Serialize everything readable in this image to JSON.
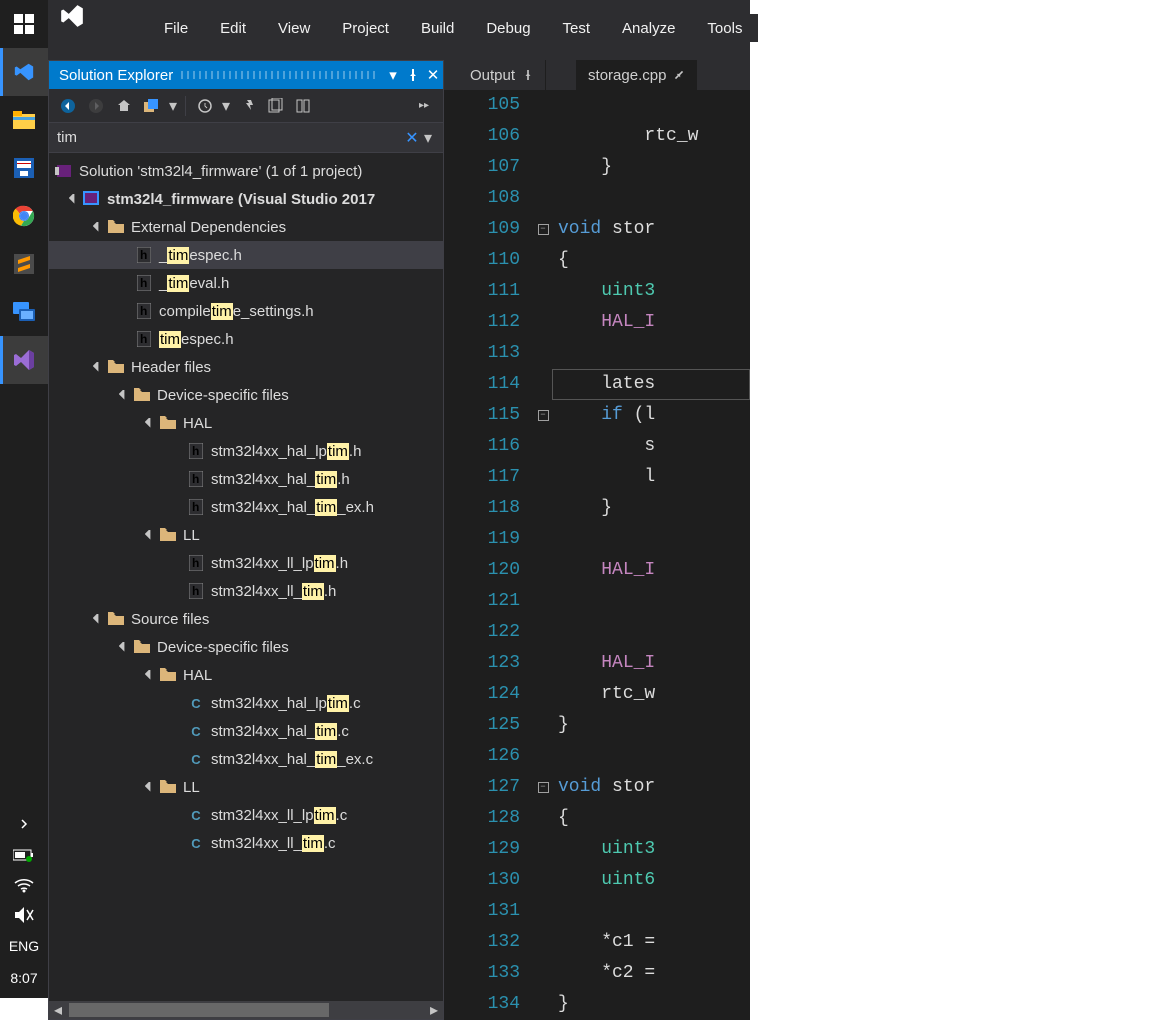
{
  "taskbar": {
    "items": [
      "start",
      "vscode",
      "file-explorer",
      "save",
      "chrome",
      "sublime",
      "remote",
      "visual-studio"
    ],
    "lang": "ENG",
    "time": "8:07"
  },
  "menubar": [
    "File",
    "Edit",
    "View",
    "Project",
    "Build",
    "Debug",
    "Test",
    "Analyze",
    "Tools"
  ],
  "solution_explorer": {
    "title": "Solution Explorer",
    "search": "tim",
    "solution_line": "Solution 'stm32l4_firmware' (1 of 1 project)",
    "project": "stm32l4_firmware (Visual Studio 2017",
    "ext_deps": "External Dependencies",
    "files": {
      "timespec_h": {
        "pre": "_",
        "hl": "tim",
        "post": "espec.h"
      },
      "timeval_h": {
        "pre": "_",
        "hl": "tim",
        "post": "eval.h"
      },
      "compiletime": {
        "pre": "compile",
        "hl": "tim",
        "post": "e_settings.h"
      },
      "timespec2": {
        "pre": "",
        "hl": "tim",
        "post": "espec.h"
      }
    },
    "header_files": "Header files",
    "device_specific": "Device-specific files",
    "hal": "HAL",
    "ll": "LL",
    "hal_h": [
      {
        "pre": "stm32l4xx_hal_lp",
        "hl": "tim",
        "post": ".h"
      },
      {
        "pre": "stm32l4xx_hal_",
        "hl": "tim",
        "post": ".h"
      },
      {
        "pre": "stm32l4xx_hal_",
        "hl": "tim",
        "post": "_ex.h"
      }
    ],
    "ll_h": [
      {
        "pre": "stm32l4xx_ll_lp",
        "hl": "tim",
        "post": ".h"
      },
      {
        "pre": "stm32l4xx_ll_",
        "hl": "tim",
        "post": ".h"
      }
    ],
    "source_files": "Source files",
    "hal_c": [
      {
        "pre": "stm32l4xx_hal_lp",
        "hl": "tim",
        "post": ".c"
      },
      {
        "pre": "stm32l4xx_hal_",
        "hl": "tim",
        "post": ".c"
      },
      {
        "pre": "stm32l4xx_hal_",
        "hl": "tim",
        "post": "_ex.c"
      }
    ],
    "ll_c": [
      {
        "pre": "stm32l4xx_ll_lp",
        "hl": "tim",
        "post": ".c"
      },
      {
        "pre": "stm32l4xx_ll_",
        "hl": "tim",
        "post": ".c"
      }
    ]
  },
  "tabs": {
    "output": "Output",
    "file": "storage.cpp"
  },
  "code": {
    "start": 105,
    "lines": [
      {
        "n": 105,
        "html": ""
      },
      {
        "n": 106,
        "html": "        rtc_w"
      },
      {
        "n": 107,
        "html": "    <span class='brace'>}</span>"
      },
      {
        "n": 108,
        "html": ""
      },
      {
        "n": 109,
        "html": "<span class='kw'>void</span> stor",
        "fold": "-"
      },
      {
        "n": 110,
        "html": "<span class='brace'>{</span>"
      },
      {
        "n": 111,
        "html": "    <span class='type'>uint3</span>"
      },
      {
        "n": 112,
        "html": "    <span class='fn'>HAL_I</span>"
      },
      {
        "n": 113,
        "html": ""
      },
      {
        "n": 114,
        "html": "    lates",
        "cursor": true
      },
      {
        "n": 115,
        "html": "    <span class='kw'>if</span> (l",
        "fold": "-"
      },
      {
        "n": 116,
        "html": "        s"
      },
      {
        "n": 117,
        "html": "        l"
      },
      {
        "n": 118,
        "html": "    <span class='brace'>}</span>"
      },
      {
        "n": 119,
        "html": ""
      },
      {
        "n": 120,
        "html": "    <span class='fn'>HAL_I</span>"
      },
      {
        "n": 121,
        "html": ""
      },
      {
        "n": 122,
        "html": ""
      },
      {
        "n": 123,
        "html": "    <span class='fn'>HAL_I</span>"
      },
      {
        "n": 124,
        "html": "    rtc_w"
      },
      {
        "n": 125,
        "html": "<span class='brace'>}</span>"
      },
      {
        "n": 126,
        "html": ""
      },
      {
        "n": 127,
        "html": "<span class='kw'>void</span> stor",
        "fold": "-"
      },
      {
        "n": 128,
        "html": "<span class='brace'>{</span>"
      },
      {
        "n": 129,
        "html": "    <span class='type'>uint3</span>"
      },
      {
        "n": 130,
        "html": "    <span class='type'>uint6</span>"
      },
      {
        "n": 131,
        "html": ""
      },
      {
        "n": 132,
        "html": "    *c1 ="
      },
      {
        "n": 133,
        "html": "    *c2 ="
      },
      {
        "n": 134,
        "html": "<span class='brace'>}</span>"
      }
    ]
  }
}
